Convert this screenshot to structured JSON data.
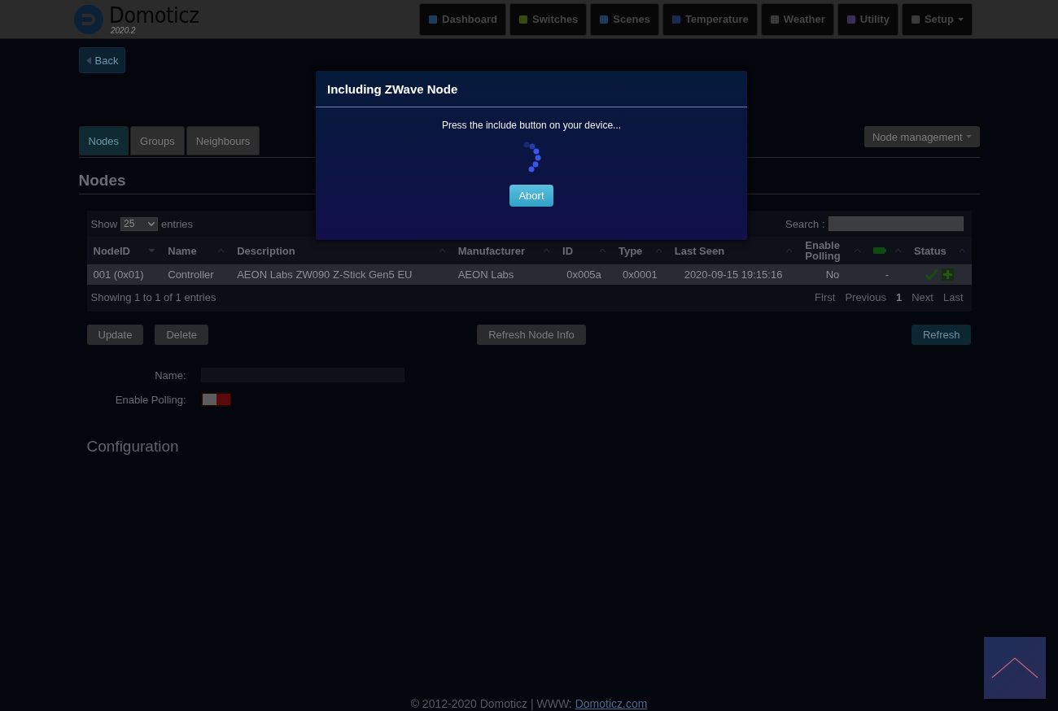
{
  "header": {
    "logo_name": "Domoticz",
    "logo_version": "2020.2",
    "nav": [
      {
        "label": "Dashboard",
        "kind": "link"
      },
      {
        "label": "Switches",
        "kind": "link"
      },
      {
        "label": "Scenes",
        "kind": "link"
      },
      {
        "label": "Temperature",
        "kind": "link"
      },
      {
        "label": "Weather",
        "kind": "link"
      },
      {
        "label": "Utility",
        "kind": "link"
      },
      {
        "label": "Setup",
        "kind": "dropdown"
      }
    ]
  },
  "back_button": "Back",
  "tabs": [
    {
      "label": "Nodes",
      "selected": true
    },
    {
      "label": "Groups",
      "selected": false
    },
    {
      "label": "Neighbours",
      "selected": false
    }
  ],
  "node_management": "Node management",
  "section_title": "Nodes",
  "table": {
    "show_label": "Show",
    "page_size": "25",
    "entries_label": "entries",
    "search_label": "Search :",
    "columns": [
      {
        "kind": "text",
        "label": "NodeID",
        "sorted": true
      },
      {
        "kind": "text",
        "label": "Name",
        "sorted": false
      },
      {
        "kind": "text",
        "label": "Description",
        "sorted": false
      },
      {
        "kind": "text",
        "label": "Manufacturer",
        "sorted": false
      },
      {
        "kind": "text",
        "label": "ID",
        "sorted": false
      },
      {
        "kind": "text",
        "label": "Type",
        "sorted": false
      },
      {
        "kind": "text",
        "label": "Last Seen",
        "sorted": false
      },
      {
        "kind": "text",
        "label": "Enable Polling",
        "sorted": false
      },
      {
        "kind": "battery",
        "sorted": false
      },
      {
        "kind": "text",
        "label": "Status",
        "sorted": false
      }
    ],
    "rows": [
      {
        "selected": true,
        "cells": [
          "001 (0x01)",
          "Controller",
          "AEON Labs ZW090 Z-Stick Gen5 EU",
          "AEON Labs",
          "0x005a",
          "0x0001",
          "2020-09-15 19:15:16",
          "No",
          "-"
        ]
      }
    ],
    "info": "Showing 1 to 1 of 1 entries",
    "pagination": [
      "First",
      "Previous",
      "1",
      "Next",
      "Last"
    ]
  },
  "buttons": {
    "update": "Update",
    "delete": "Delete",
    "refresh_info": "Refresh Node Info",
    "refresh": "Refresh"
  },
  "form": {
    "name_label": "Name:",
    "polling_label": "Enable Polling:",
    "polling_on": false
  },
  "configuration_title": "Configuration",
  "footer": {
    "text": "© 2012-2020 Domoticz | WWW: ",
    "link": "Domoticz.com"
  },
  "modal": {
    "title": "Including ZWave Node",
    "message": "Press the include button on your device...",
    "abort": "Abort"
  }
}
